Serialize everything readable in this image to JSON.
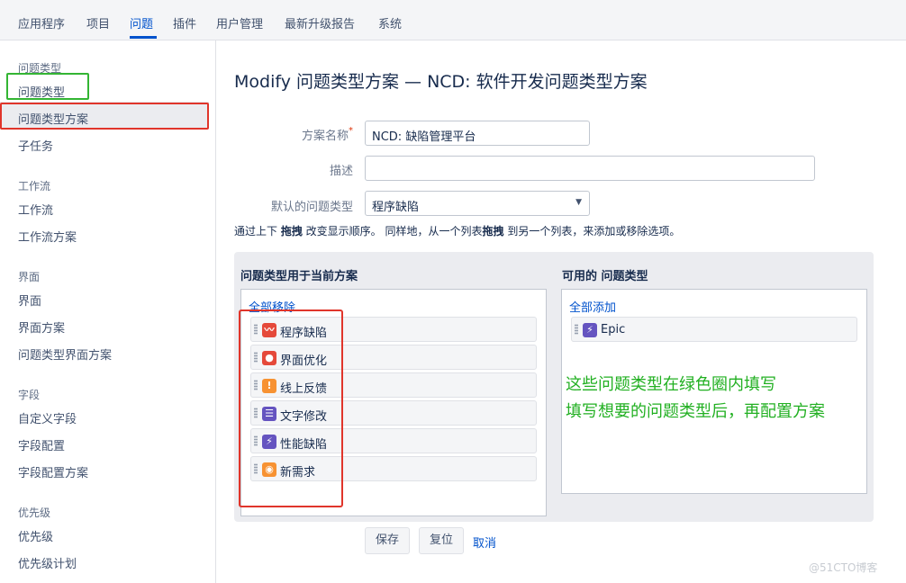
{
  "topnav": {
    "items": [
      "应用程序",
      "项目",
      "问题",
      "插件",
      "用户管理",
      "最新升级报告",
      "系统"
    ],
    "active": "问题"
  },
  "sidebar": {
    "sections": [
      {
        "heading": "问题类型",
        "items": [
          "问题类型",
          "问题类型方案",
          "子任务"
        ]
      },
      {
        "heading": "工作流",
        "items": [
          "工作流",
          "工作流方案"
        ]
      },
      {
        "heading": "界面",
        "items": [
          "界面",
          "界面方案",
          "问题类型界面方案"
        ]
      },
      {
        "heading": "字段",
        "items": [
          "自定义字段",
          "字段配置",
          "字段配置方案"
        ]
      },
      {
        "heading": "优先级",
        "items": [
          "优先级",
          "优先级计划"
        ]
      }
    ],
    "selected": "问题类型方案"
  },
  "form": {
    "title": "Modify 问题类型方案 — NCD: 软件开发问题类型方案",
    "name_label": "方案名称",
    "name_required": "*",
    "name_value": "NCD: 缺陷管理平台",
    "desc_label": "描述",
    "desc_value": "",
    "default_label": "默认的问题类型",
    "default_value": "程序缺陷",
    "hint_parts": [
      "通过上下 ",
      "拖拽",
      " 改变显示顺序。 同样地，从一个列表",
      "拖拽",
      " 到另一个列表，来添加或移除选项。"
    ]
  },
  "current": {
    "title": "问题类型用于当前方案",
    "remove_all": "全部移除",
    "types": [
      {
        "name": "程序缺陷",
        "icon": "bug-icon",
        "color": "#e5493a",
        "glyph": "〰"
      },
      {
        "name": "界面优化",
        "icon": "improvement-icon",
        "color": "#e5493a",
        "glyph": "●"
      },
      {
        "name": "线上反馈",
        "icon": "feedback-icon",
        "color": "#f79232",
        "glyph": "!"
      },
      {
        "name": "文字修改",
        "icon": "text-icon",
        "color": "#6554c0",
        "glyph": "☰"
      },
      {
        "name": "性能缺陷",
        "icon": "performance-icon",
        "color": "#6554c0",
        "glyph": "⚡"
      },
      {
        "name": "新需求",
        "icon": "new-feature-icon",
        "color": "#f79232",
        "glyph": "💡"
      }
    ]
  },
  "available": {
    "title": "可用的 问题类型",
    "add_all": "全部添加",
    "types": [
      {
        "name": "Epic",
        "icon": "epic-icon",
        "color": "#6554c0",
        "glyph": "⚡"
      }
    ]
  },
  "annotation": [
    "这些问题类型在绿色圈内填写",
    "填写想要的问题类型后，再配置方案"
  ],
  "buttons": {
    "save": "保存",
    "reset": "复位",
    "cancel": "取消"
  },
  "watermark": "@51CTO博客"
}
